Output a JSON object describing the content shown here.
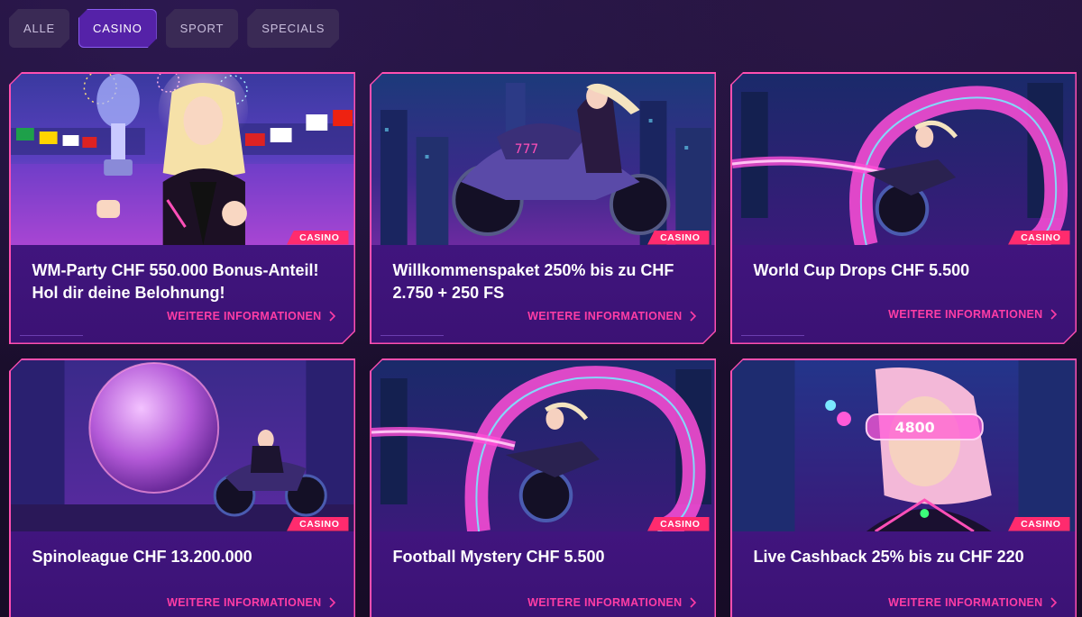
{
  "tabs": [
    {
      "label": "ALLE",
      "active": false
    },
    {
      "label": "CASINO",
      "active": true
    },
    {
      "label": "SPORT",
      "active": false
    },
    {
      "label": "SPECIALS",
      "active": false
    }
  ],
  "cards": [
    {
      "title": "WM-Party CHF 550.000 Bonus-Anteil! Hol dir deine Belohnung!",
      "badge": "CASINO",
      "link": "WEITERE INFORMATIONEN",
      "art": "trophy-woman-stadium"
    },
    {
      "title": "Willkommenspaket 250% bis zu CHF 2.750 + 250 FS",
      "badge": "CASINO",
      "link": "WEITERE INFORMATIONEN",
      "art": "motorbike-rider-city"
    },
    {
      "title": "World Cup Drops CHF 5.500",
      "badge": "CASINO",
      "link": "WEITERE INFORMATIONEN",
      "art": "neon-loop-rider"
    },
    {
      "title": "Spinoleague CHF 13.200.000",
      "badge": "CASINO",
      "link": "WEITERE INFORMATIONEN",
      "art": "sphere-rider"
    },
    {
      "title": "Football Mystery CHF 5.500",
      "badge": "CASINO",
      "link": "WEITERE INFORMATIONEN",
      "art": "neon-loop-rider"
    },
    {
      "title": "Live Cashback 25% bis zu CHF 220",
      "badge": "CASINO",
      "link": "WEITERE INFORMATIONEN",
      "art": "visor-woman"
    }
  ],
  "colors": {
    "accent": "#ff3da5",
    "badge": "#ff2b6e",
    "card": "#4a1a8f",
    "tab_active": "#5522a8"
  }
}
